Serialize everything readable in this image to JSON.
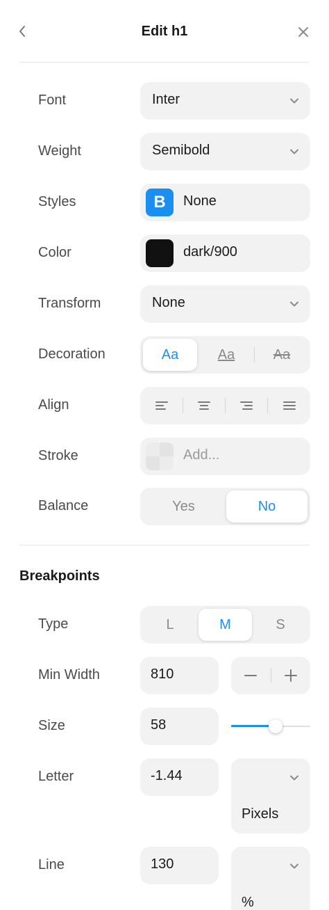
{
  "header": {
    "title": "Edit h1"
  },
  "font": {
    "label": "Font",
    "value": "Inter"
  },
  "weight": {
    "label": "Weight",
    "value": "Semibold"
  },
  "styles": {
    "label": "Styles",
    "badge": "B",
    "value": "None"
  },
  "color": {
    "label": "Color",
    "value": "dark/900",
    "swatch": "#111111"
  },
  "transform": {
    "label": "Transform",
    "value": "None"
  },
  "decoration": {
    "label": "Decoration",
    "options": [
      "Aa",
      "Aa",
      "Aa"
    ],
    "active": 0
  },
  "align": {
    "label": "Align",
    "options": [
      "align-left-icon",
      "align-center-icon",
      "align-right-icon",
      "align-justify-icon"
    ]
  },
  "stroke": {
    "label": "Stroke",
    "placeholder": "Add..."
  },
  "balance": {
    "label": "Balance",
    "options": [
      "Yes",
      "No"
    ],
    "active": 1
  },
  "breakpoints": {
    "title": "Breakpoints",
    "type": {
      "label": "Type",
      "options": [
        "L",
        "M",
        "S"
      ],
      "active": 1
    },
    "min_width": {
      "label": "Min Width",
      "value": "810"
    },
    "size": {
      "label": "Size",
      "value": "58",
      "slider_fraction": 0.56
    },
    "letter": {
      "label": "Letter",
      "value": "-1.44",
      "unit": "Pixels"
    },
    "line": {
      "label": "Line",
      "value": "130",
      "unit": "%"
    }
  },
  "colors": {
    "accent": "#1a8ff0",
    "field_bg": "#f2f2f2",
    "label": "#4a4a4a"
  }
}
